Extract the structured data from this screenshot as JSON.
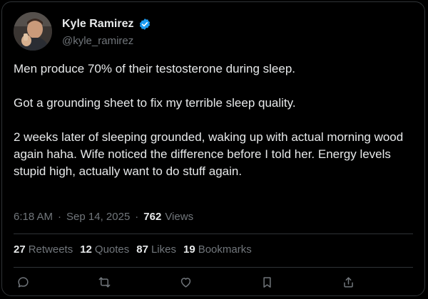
{
  "author": {
    "name": "Kyle Ramirez",
    "handle": "@kyle_ramirez",
    "verified": true
  },
  "tweet": {
    "paragraphs": [
      "Men produce 70% of their testosterone during sleep.",
      "Got a grounding sheet to fix my terrible sleep quality.",
      "2 weeks later of sleeping grounded, waking up with actual morning wood again haha. Wife noticed the difference before I told her. Energy levels stupid high, actually want to do stuff again."
    ],
    "time": "6:18 AM",
    "date": "Sep 14, 2025",
    "separator": "·",
    "views_count": "762",
    "views_label": "Views"
  },
  "stats": {
    "retweets": {
      "count": "27",
      "label": "Retweets"
    },
    "quotes": {
      "count": "12",
      "label": "Quotes"
    },
    "likes": {
      "count": "87",
      "label": "Likes"
    },
    "bookmarks": {
      "count": "19",
      "label": "Bookmarks"
    }
  },
  "actions": [
    "reply-icon",
    "retweet-icon",
    "like-icon",
    "bookmark-icon",
    "share-icon"
  ],
  "colors": {
    "background": "#000000",
    "text": "#e7e9ea",
    "secondary": "#71767b",
    "border": "#2f3336",
    "verified": "#1d9bf0"
  }
}
